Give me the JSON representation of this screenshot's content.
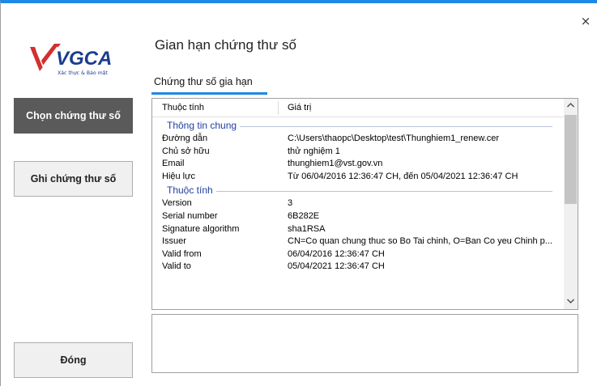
{
  "window": {
    "close_glyph": "×"
  },
  "logo": {
    "brand": "VGCA",
    "tagline": "Xác thực & Bảo mật"
  },
  "sidebar": {
    "select_cert_label": "Chọn chứng thư số",
    "write_cert_label": "Ghi chứng thư số",
    "close_label": "Đóng"
  },
  "header": {
    "title": "Gian hạn chứng thư số",
    "tab_label": "Chứng thư số gia hạn"
  },
  "list": {
    "col_property": "Thuộc tính",
    "col_value": "Giá trị",
    "groups": [
      {
        "name": "Thông tin chung",
        "rows": [
          {
            "k": "Đường dẫn",
            "v": "C:\\Users\\thaopc\\Desktop\\test\\Thunghiem1_renew.cer"
          },
          {
            "k": "Chủ sở hữu",
            "v": "thử nghiệm 1"
          },
          {
            "k": "Email",
            "v": "thunghiem1@vst.gov.vn"
          },
          {
            "k": "Hiệu lực",
            "v": "Từ 06/04/2016 12:36:47 CH, đến 05/04/2021 12:36:47 CH"
          }
        ]
      },
      {
        "name": "Thuộc tính",
        "rows": [
          {
            "k": "Version",
            "v": "3"
          },
          {
            "k": "Serial number",
            "v": "6B282E"
          },
          {
            "k": "Signature algorithm",
            "v": "sha1RSA"
          },
          {
            "k": "Issuer",
            "v": "CN=Co quan chung thuc so Bo Tai chinh, O=Ban Co yeu Chinh p..."
          },
          {
            "k": "Valid from",
            "v": "06/04/2016 12:36:47 CH"
          },
          {
            "k": "Valid to",
            "v": "05/04/2021 12:36:47 CH"
          }
        ]
      }
    ]
  },
  "detail": {
    "text": ""
  },
  "colors": {
    "accent": "#1e88e5",
    "active_button": "#5a5a5a",
    "group_heading": "#1f3fa0",
    "logo_red": "#d32f2f",
    "logo_blue": "#1a3d8f"
  },
  "icons": {
    "close": "close-icon",
    "scroll_up": "chevron-up-icon",
    "scroll_down": "chevron-down-icon"
  }
}
